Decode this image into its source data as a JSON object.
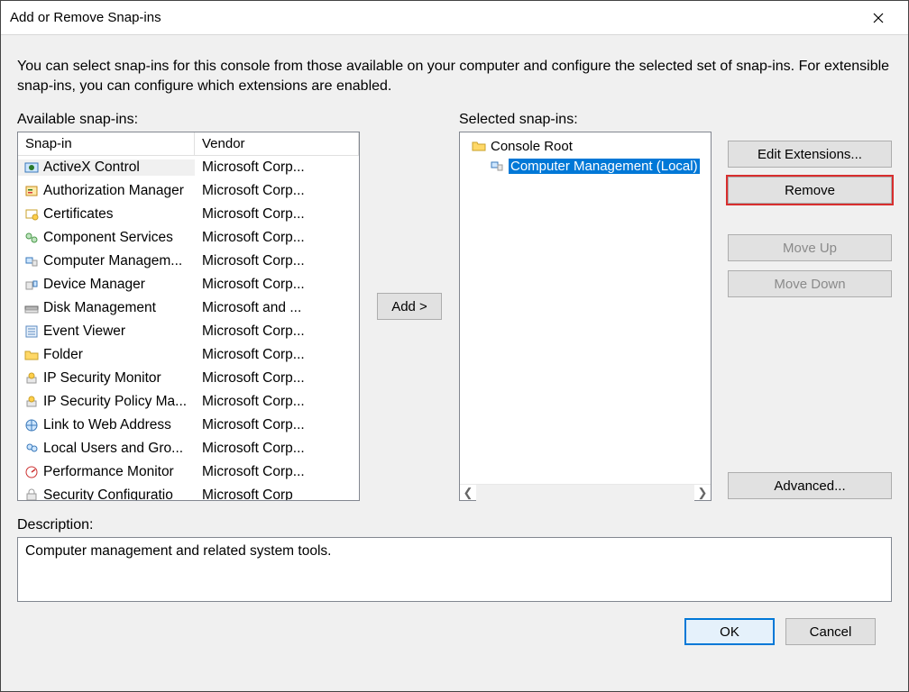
{
  "title": "Add or Remove Snap-ins",
  "intro": "You can select snap-ins for this console from those available on your computer and configure the selected set of snap-ins. For extensible snap-ins, you can configure which extensions are enabled.",
  "labels": {
    "available": "Available snap-ins:",
    "selected": "Selected snap-ins:",
    "description": "Description:"
  },
  "columns": {
    "snapin": "Snap-in",
    "vendor": "Vendor"
  },
  "available": [
    {
      "name": "ActiveX Control",
      "vendor": "Microsoft Corp...",
      "icon": "activex",
      "selected": true
    },
    {
      "name": "Authorization Manager",
      "vendor": "Microsoft Corp...",
      "icon": "authz"
    },
    {
      "name": "Certificates",
      "vendor": "Microsoft Corp...",
      "icon": "cert"
    },
    {
      "name": "Component Services",
      "vendor": "Microsoft Corp...",
      "icon": "compsvc"
    },
    {
      "name": "Computer Managem...",
      "vendor": "Microsoft Corp...",
      "icon": "compmgmt"
    },
    {
      "name": "Device Manager",
      "vendor": "Microsoft Corp...",
      "icon": "devmgr"
    },
    {
      "name": "Disk Management",
      "vendor": "Microsoft and ...",
      "icon": "diskmgmt"
    },
    {
      "name": "Event Viewer",
      "vendor": "Microsoft Corp...",
      "icon": "eventvwr"
    },
    {
      "name": "Folder",
      "vendor": "Microsoft Corp...",
      "icon": "folder"
    },
    {
      "name": "IP Security Monitor",
      "vendor": "Microsoft Corp...",
      "icon": "ipsecmon"
    },
    {
      "name": "IP Security Policy Ma...",
      "vendor": "Microsoft Corp...",
      "icon": "ipsecpol"
    },
    {
      "name": "Link to Web Address",
      "vendor": "Microsoft Corp...",
      "icon": "weblink"
    },
    {
      "name": "Local Users and Gro...",
      "vendor": "Microsoft Corp...",
      "icon": "localusr"
    },
    {
      "name": "Performance Monitor",
      "vendor": "Microsoft Corp...",
      "icon": "perfmon"
    },
    {
      "name": "Security Configuratio",
      "vendor": "Microsoft Corp",
      "icon": "seccfg"
    }
  ],
  "tree": {
    "root": "Console Root",
    "items": [
      {
        "name": "Computer Management (Local)",
        "selected": true,
        "icon": "compmgmt"
      }
    ]
  },
  "buttons": {
    "add": "Add >",
    "edit_ext": "Edit Extensions...",
    "remove": "Remove",
    "move_up": "Move Up",
    "move_down": "Move Down",
    "advanced": "Advanced...",
    "ok": "OK",
    "cancel": "Cancel"
  },
  "description_text": "Computer management and related system tools."
}
